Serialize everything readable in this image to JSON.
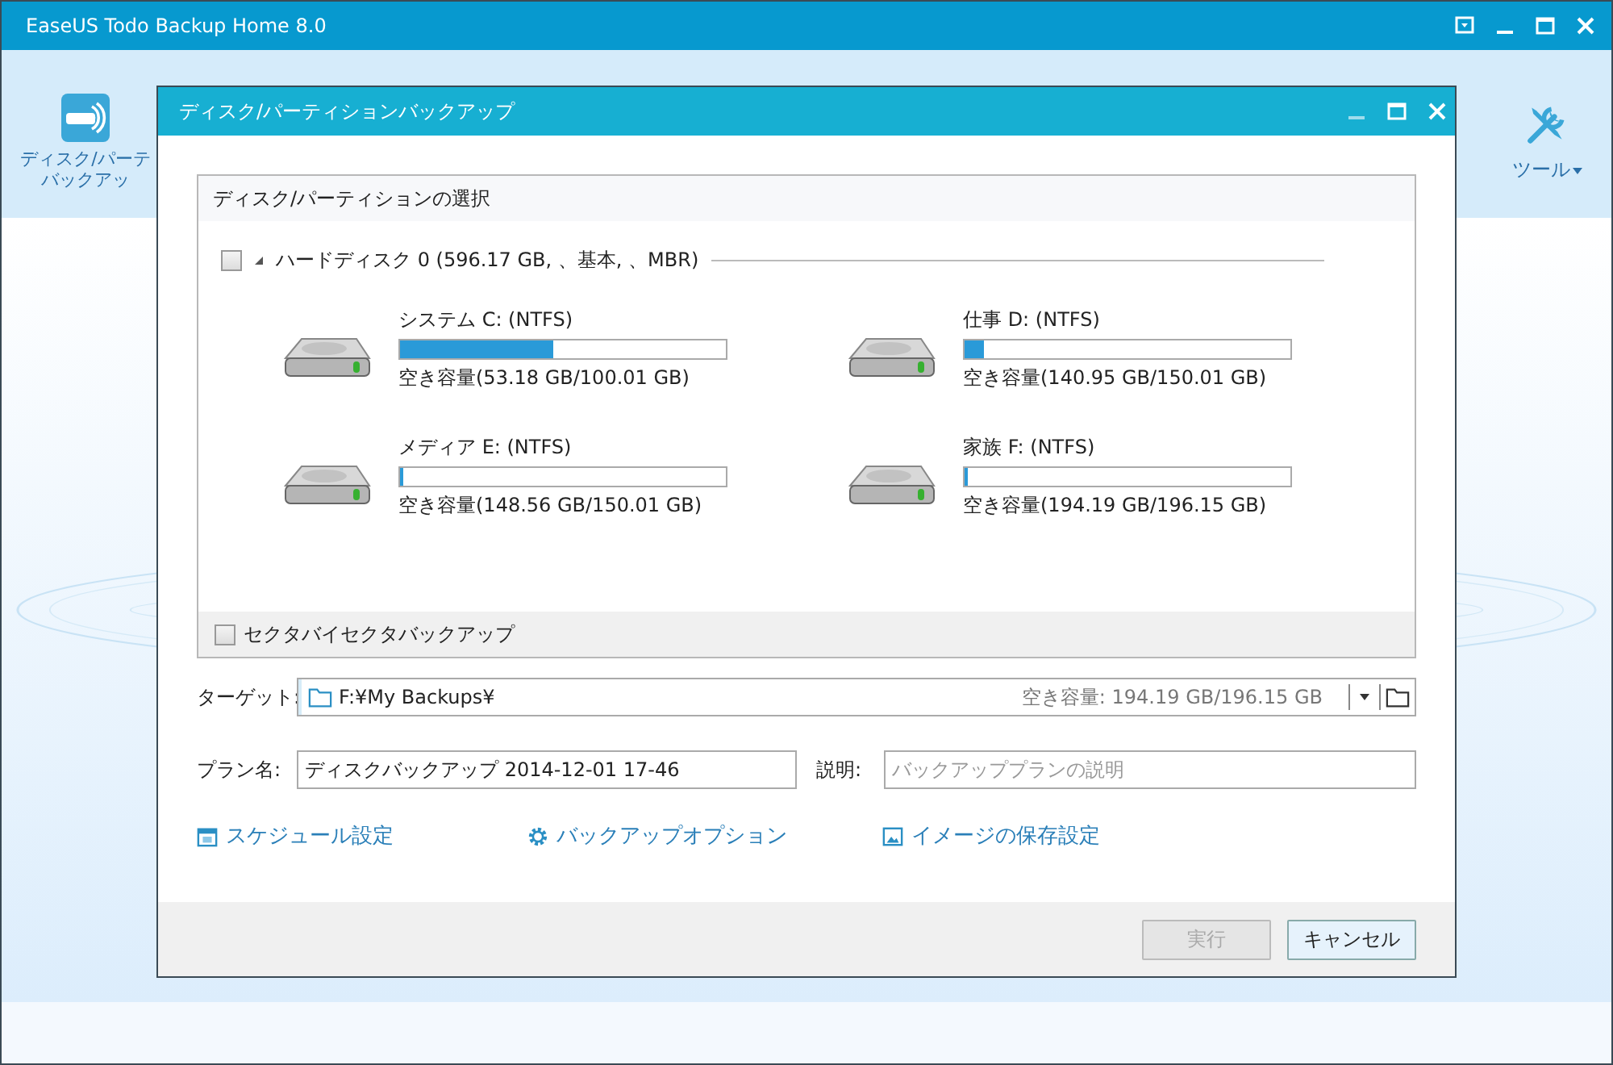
{
  "main_window": {
    "title": "EaseUS Todo Backup Home 8.0",
    "toolbar_left": {
      "lines": [
        "ディスク/パーテ",
        "バックアッ"
      ]
    },
    "toolbar_right": {
      "label": "ツール"
    }
  },
  "dialog": {
    "title": "ディスク/パーティションバックアップ",
    "group": {
      "title": "ディスク/パーティションの選択",
      "disk": {
        "label": "ハードディスク 0 (596.17 GB, 、基本, 、MBR)",
        "checked": false,
        "expanded": true
      },
      "partitions": [
        {
          "name": "システム C: (NTFS)",
          "level": 0.47,
          "free": "空き容量(53.18 GB/100.01 GB)"
        },
        {
          "name": "仕事 D: (NTFS)",
          "level": 0.06,
          "free": "空き容量(140.95 GB/150.01 GB)"
        },
        {
          "name": "メディア E: (NTFS)",
          "level": 0.01,
          "free": "空き容量(148.56 GB/150.01 GB)"
        },
        {
          "name": "家族 F: (NTFS)",
          "level": 0.01,
          "free": "空き容量(194.19 GB/196.15 GB)"
        }
      ],
      "sector_backup": {
        "label": "セクタバイセクタバックアップ",
        "checked": false
      }
    },
    "target": {
      "label": "ターゲット:",
      "value": "F:¥My Backups¥",
      "free": "空き容量: 194.19 GB/196.15 GB"
    },
    "plan": {
      "label": "プラン名:",
      "value": "ディスクバックアップ 2014-12-01 17-46"
    },
    "description": {
      "label": "説明:",
      "placeholder": "バックアッププランの説明"
    },
    "links": [
      {
        "kind": "schedule",
        "label": "スケジュール設定"
      },
      {
        "kind": "options",
        "label": "バックアップオプション"
      },
      {
        "kind": "image",
        "label": "イメージの保存設定"
      }
    ],
    "buttons": [
      {
        "label": "実行",
        "disabled": true
      },
      {
        "label": "キャンセル",
        "disabled": false
      }
    ]
  }
}
